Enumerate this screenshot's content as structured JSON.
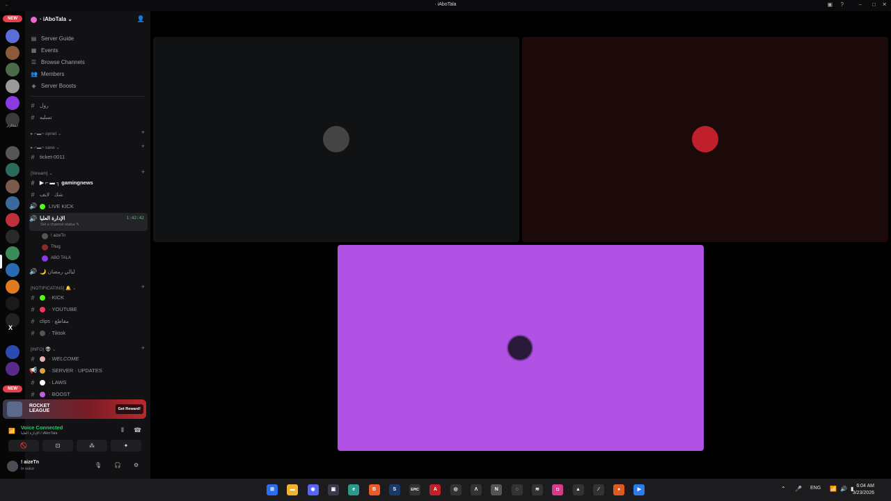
{
  "window": {
    "title": "· iAboTala",
    "nav_back": "←",
    "controls": {
      "inbox": "▣",
      "help": "?",
      "minimize": "–",
      "maximize": "□",
      "close": "✕"
    }
  },
  "server_rail": {
    "new_badge_top": "NEW",
    "new_badge_bottom": "NEW",
    "icons": [
      {
        "name": "server-1",
        "color": "#5b6dd6"
      },
      {
        "name": "server-2",
        "color": "#8a5a3a"
      },
      {
        "name": "server-3",
        "color": "#4a6a4a"
      },
      {
        "name": "server-4",
        "color": "#9a9a9a"
      },
      {
        "name": "server-5",
        "color": "#8a3ae0"
      },
      {
        "name": "server-6",
        "color": "#3a3a3a"
      },
      {
        "name": "server-7",
        "color": "#555555"
      },
      {
        "name": "server-8",
        "color": "#2a6a5a"
      },
      {
        "name": "server-9",
        "color": "#7a5a4a"
      },
      {
        "name": "server-10",
        "color": "#3a6a9a"
      },
      {
        "name": "server-11",
        "color": "#c0303a"
      },
      {
        "name": "server-12",
        "color": "#2a2a2a"
      },
      {
        "name": "server-13",
        "color": "#3a8a5a"
      },
      {
        "name": "server-14",
        "color": "#2a6ab0"
      },
      {
        "name": "server-15",
        "color": "#e07a20"
      },
      {
        "name": "server-16",
        "color": "#1a1a1a"
      },
      {
        "name": "server-17",
        "color": "#222222"
      },
      {
        "name": "server-18",
        "color": "#2a4ab0"
      },
      {
        "name": "server-19",
        "color": "#5a2a8a"
      }
    ],
    "folder_label": "ايمتالزم",
    "x_label": "X"
  },
  "sidebar": {
    "server_name": "· iAboTala ⌄",
    "invite_icon": "👤",
    "menu": [
      {
        "icon": "▤",
        "label": "Server Guide"
      },
      {
        "icon": "▦",
        "label": "Events"
      },
      {
        "icon": "☰",
        "label": "Browse Channels"
      },
      {
        "icon": "👥",
        "label": "Members"
      },
      {
        "icon": "◈",
        "label": "Server Boosts"
      }
    ],
    "channels_top": [
      {
        "icon": "#",
        "label": "رول"
      },
      {
        "icon": "#",
        "label": "تسليه"
      }
    ],
    "categories": {
      "opnet": "▸ ⌐▬¬ opnet ⌄",
      "save": "▸ ⌐▬¬ save ⌄",
      "stream": "[Stream] ⌄",
      "notifications": "[NOTIFICATINS] 🔔 ⌄",
      "info": "[INFO] 👽 ⌄"
    },
    "ticket": "ticket-0011",
    "gamingnews": "▶ ⌐ ▬ ┐ gamingnews",
    "live": "شك · لايف",
    "live_kick": "LIVE KICK",
    "active_voice": {
      "label": "الإدارة العليا",
      "timer": "1:42:42",
      "status": "Set a channel status ✎"
    },
    "voice_users": [
      {
        "name": "! aizeTn",
        "color": "#555"
      },
      {
        "name": "Thug",
        "color": "#8a2a2a"
      },
      {
        "name": "ABO TALA",
        "color": "#8a3ae0"
      }
    ],
    "ramadan": "🌙 ليالي رمضان",
    "notif_channels": [
      {
        "label": "· KICK",
        "dot": "#53fc18"
      },
      {
        "label": "· YOUTUBE",
        "dot": "#ff3358"
      },
      {
        "label": "clips · مقاطع",
        "dot": null
      },
      {
        "label": "· Tiktok",
        "dot": "#555555"
      }
    ],
    "info_channels": [
      {
        "icon": "#",
        "label": "· WELCOME",
        "dot": "#e8b0b0"
      },
      {
        "icon": "📢",
        "label": "· SERVER · UPDATES",
        "dot": "#e0a040"
      },
      {
        "icon": "#",
        "label": "· LAWS",
        "dot": "#ffffff"
      },
      {
        "icon": "#",
        "label": "· BOOST",
        "dot": "#c060e0"
      }
    ]
  },
  "promo": {
    "game": "ROCKET LEAGUE",
    "cta": "Get Reward!"
  },
  "voice_panel": {
    "status": "Voice Connected",
    "channel": "الإدارة العليا / iAboTala",
    "buttons": [
      "🚫",
      "⊡",
      "⁂",
      "✦"
    ]
  },
  "user_panel": {
    "name": "! aizeTn",
    "status": "In voice",
    "mic": "🎙",
    "headset": "🎧",
    "settings": "⚙"
  },
  "stage": {
    "tiles": [
      {
        "name": "participant-tile-1",
        "bg": "#111214",
        "avatar_color": "#444"
      },
      {
        "name": "participant-tile-2",
        "bg": "#1c0a0b",
        "avatar_color": "#c0202a"
      },
      {
        "name": "participant-tile-3",
        "bg": "#b152e4",
        "avatar_color": "#2a1a3a"
      }
    ]
  },
  "taskbar": {
    "apps": [
      {
        "name": "start",
        "glyph": "⊞",
        "color": "#2a6ef0"
      },
      {
        "name": "explorer",
        "glyph": "▬",
        "color": "#f0b030"
      },
      {
        "name": "discord",
        "glyph": "◉",
        "color": "#5865f2"
      },
      {
        "name": "store",
        "glyph": "▣",
        "color": "#3a3a4a"
      },
      {
        "name": "edge",
        "glyph": "e",
        "color": "#2a9a8a"
      },
      {
        "name": "brave",
        "glyph": "B",
        "color": "#f05a28"
      },
      {
        "name": "steam",
        "glyph": "S",
        "color": "#1a3a6a"
      },
      {
        "name": "epic",
        "glyph": "EPIC",
        "color": "#333"
      },
      {
        "name": "adobe",
        "glyph": "A",
        "color": "#c0202a"
      },
      {
        "name": "obs",
        "glyph": "◎",
        "color": "#333"
      },
      {
        "name": "app-a",
        "glyph": "Λ",
        "color": "#333"
      },
      {
        "name": "notion",
        "glyph": "N",
        "color": "#555"
      },
      {
        "name": "app-ring",
        "glyph": "◌",
        "color": "#333"
      },
      {
        "name": "app-wave",
        "glyph": "≋",
        "color": "#333"
      },
      {
        "name": "instagram",
        "glyph": "◘",
        "color": "#d83a8a"
      },
      {
        "name": "app-delta",
        "glyph": "▲",
        "color": "#333"
      },
      {
        "name": "app-pen",
        "glyph": "∕",
        "color": "#333"
      },
      {
        "name": "app-orange",
        "glyph": "●",
        "color": "#e05a20"
      },
      {
        "name": "app-blue",
        "glyph": "▶",
        "color": "#2a7af0"
      }
    ],
    "tray": {
      "chevron": "⌃",
      "mic": "🎤",
      "lang": "ENG",
      "wifi": "📶",
      "volume": "🔊",
      "battery": "▮"
    },
    "time": "6:04 AM",
    "date": "3/23/2026"
  }
}
